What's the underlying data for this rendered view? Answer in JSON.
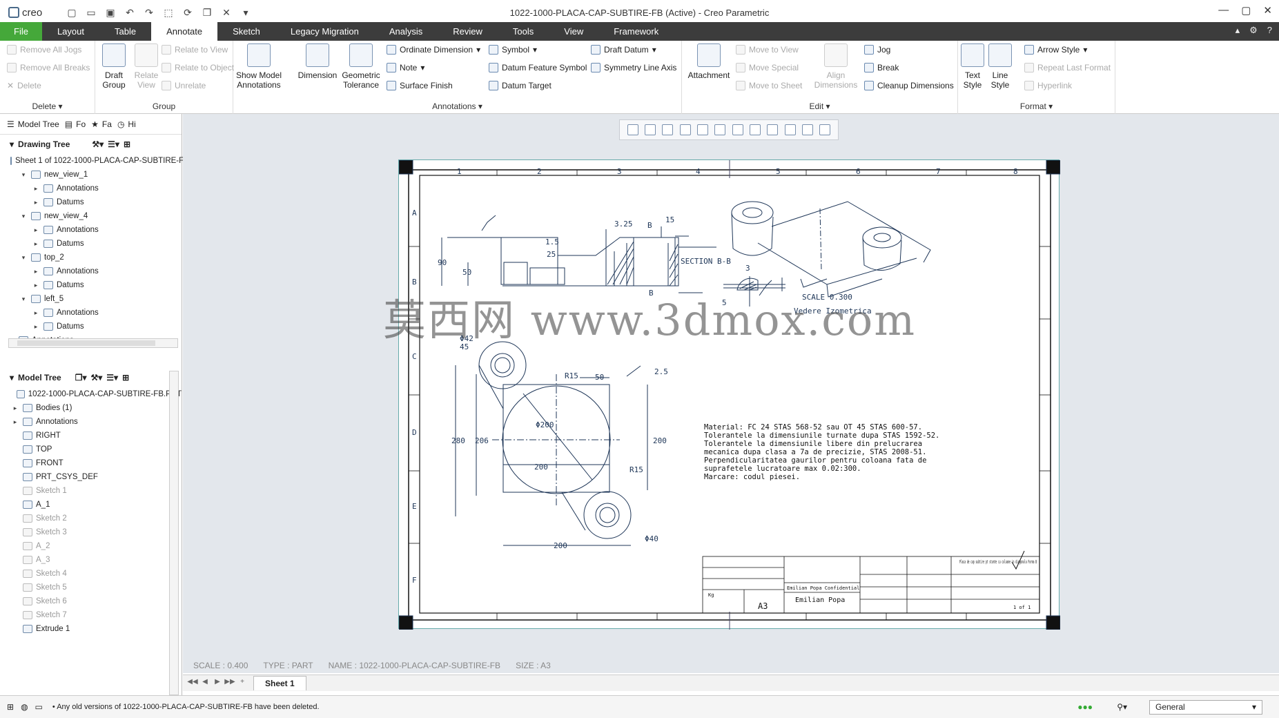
{
  "app": {
    "logo": "creo",
    "window_title": "1022-1000-PLACA-CAP-SUBTIRE-FB (Active) - Creo Parametric"
  },
  "menu": {
    "tabs": [
      "File",
      "Layout",
      "Table",
      "Annotate",
      "Sketch",
      "Legacy Migration",
      "Analysis",
      "Review",
      "Tools",
      "View",
      "Framework"
    ],
    "active": "Annotate"
  },
  "ribbon": {
    "delete_group": {
      "label": "Delete",
      "items": [
        "Remove All Jogs",
        "Remove All Breaks",
        "Delete"
      ]
    },
    "group_group": {
      "label": "Group",
      "draft_group": "Draft Group",
      "relate_view": "Relate View",
      "items": [
        "Relate to View",
        "Relate to Object",
        "Unrelate"
      ]
    },
    "annotations_group": {
      "label": "Annotations",
      "show_model": "Show Model Annotations",
      "dimension": "Dimension",
      "geom_tol": "Geometric Tolerance",
      "col1": [
        "Ordinate Dimension",
        "Note",
        "Surface Finish"
      ],
      "col2": [
        "Symbol",
        "Datum Feature Symbol",
        "Datum Target"
      ],
      "col3": [
        "Draft Datum",
        "Symmetry Line Axis"
      ]
    },
    "edit_group": {
      "label": "Edit",
      "attachment": "Attachment",
      "col1": [
        "Move to View",
        "Move Special",
        "Move to Sheet"
      ],
      "align": "Align Dimensions",
      "col2": [
        "Jog",
        "Break",
        "Cleanup Dimensions"
      ]
    },
    "format_group": {
      "label": "Format",
      "text_style": "Text Style",
      "line_style": "Line Style",
      "col": [
        "Arrow Style",
        "Repeat Last Format",
        "Hyperlink"
      ]
    }
  },
  "left_panel": {
    "tabs": [
      "Model Tree",
      "Fo",
      "Fa",
      "Hi"
    ],
    "drawing_tree_label": "Drawing Tree",
    "drawing_tree": [
      {
        "label": "Sheet 1 of 1022-1000-PLACA-CAP-SUBTIRE-F",
        "level": 0
      },
      {
        "label": "new_view_1",
        "level": 1
      },
      {
        "label": "Annotations",
        "level": 2
      },
      {
        "label": "Datums",
        "level": 2
      },
      {
        "label": "new_view_4",
        "level": 1
      },
      {
        "label": "Annotations",
        "level": 2
      },
      {
        "label": "Datums",
        "level": 2
      },
      {
        "label": "top_2",
        "level": 1
      },
      {
        "label": "Annotations",
        "level": 2
      },
      {
        "label": "Datums",
        "level": 2
      },
      {
        "label": "left_5",
        "level": 1
      },
      {
        "label": "Annotations",
        "level": 2
      },
      {
        "label": "Datums",
        "level": 2
      },
      {
        "label": "Annotations",
        "level": 0
      }
    ],
    "model_tree_label": "Model Tree",
    "model_tree": [
      {
        "label": "1022-1000-PLACA-CAP-SUBTIRE-FB.PRT",
        "grey": false
      },
      {
        "label": "Bodies (1)",
        "grey": false
      },
      {
        "label": "Annotations",
        "grey": false
      },
      {
        "label": "RIGHT",
        "grey": false
      },
      {
        "label": "TOP",
        "grey": false
      },
      {
        "label": "FRONT",
        "grey": false
      },
      {
        "label": "PRT_CSYS_DEF",
        "grey": false
      },
      {
        "label": "Sketch 1",
        "grey": true
      },
      {
        "label": "A_1",
        "grey": false
      },
      {
        "label": "Sketch 2",
        "grey": true
      },
      {
        "label": "Sketch 3",
        "grey": true
      },
      {
        "label": "A_2",
        "grey": true
      },
      {
        "label": "A_3",
        "grey": true
      },
      {
        "label": "Sketch 4",
        "grey": true
      },
      {
        "label": "Sketch 5",
        "grey": true
      },
      {
        "label": "Sketch 6",
        "grey": true
      },
      {
        "label": "Sketch 7",
        "grey": true
      },
      {
        "label": "Extrude 1",
        "grey": false
      }
    ]
  },
  "drawing": {
    "section_label": "SECTION B-B",
    "scale_label": "SCALE 0.300",
    "iso_label": "Vedere Izometrica",
    "notes": [
      "Material: FC 24 STAS 568-52 sau OT 45 STAS 600-57.",
      "Tolerantele la dimensiunile turnate dupa STAS 1592-52.",
      "Tolerantele la dimensiunile libere din prelucrarea",
      "mecanica dupa clasa a 7a de precizie, STAS 2008-51.",
      "Perpendicularitatea gaurilor pentru coloana fata de",
      "suprafetele lucratoare max 0.02:300.",
      "Marcare: codul piesei."
    ],
    "dims": {
      "d90": "90",
      "d50": "50",
      "d325": "3.25",
      "d15": "1.5",
      "d25": "25",
      "d15b": "15",
      "phi42": "Φ42",
      "d45": "45",
      "r15a": "R15",
      "d50b": "50",
      "d2_5": "2.5",
      "d280": "280",
      "d206": "206",
      "phi200": "Φ200",
      "d200a": "200",
      "d200b": "200",
      "r15b": "R15",
      "phi40": "Φ40",
      "d200c": "200",
      "d3": "3",
      "d5": "5",
      "b1": "B",
      "b2": "B"
    },
    "title_block": {
      "title": "Placa de cap subtire pt stante cu coloane in diagonala Forma B",
      "author": "Emilian Popa",
      "confidential": "Emilian Popa Confidential",
      "size": "A3",
      "weight": "Kg",
      "sheet": "1 of 1"
    },
    "zones_top": [
      "1",
      "2",
      "3",
      "4",
      "5",
      "6",
      "7",
      "8"
    ],
    "zones_side": [
      "A",
      "B",
      "C",
      "D",
      "E",
      "F"
    ]
  },
  "watermark": "莫西网 www.3dmox.com",
  "status": {
    "scale": "SCALE : 0.400",
    "type": "TYPE : PART",
    "name": "NAME : 1022-1000-PLACA-CAP-SUBTIRE-FB",
    "size": "SIZE : A3"
  },
  "sheet_tab": "Sheet 1",
  "message": "Any old versions of 1022-1000-PLACA-CAP-SUBTIRE-FB have been deleted.",
  "filter": "General"
}
